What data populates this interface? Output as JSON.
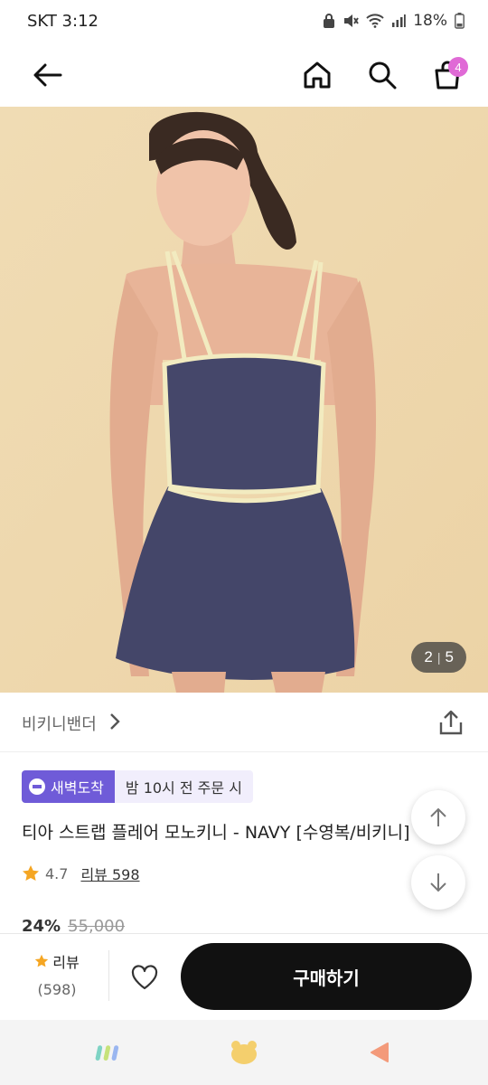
{
  "status_bar": {
    "carrier_time": "SKT  3:12",
    "battery": "18%",
    "icons": [
      "lock-icon",
      "mute-icon",
      "wifi-icon",
      "signal-icon",
      "battery-icon"
    ]
  },
  "header": {
    "cart_count": "4",
    "icons": [
      "back-arrow-icon",
      "home-icon",
      "search-icon",
      "cart-icon"
    ]
  },
  "gallery": {
    "current": "2",
    "separator": "|",
    "total": "5"
  },
  "brand": {
    "name": "비키니밴더"
  },
  "badges": {
    "primary": "새벽도착",
    "secondary": "밤 10시 전 주문 시"
  },
  "product": {
    "title": "티아 스트랩 플레어 모노키니 - NAVY [수영복/비키니]",
    "rating": "4.7",
    "reviews_link": "리뷰 598",
    "discount": "24%",
    "original_price": "55,000"
  },
  "action_bar": {
    "review_label": "리뷰",
    "review_count": "(598)",
    "buy_label": "구매하기"
  },
  "colors": {
    "accent_purple": "#6f5bd8",
    "cart_badge": "#e06ad6",
    "buy_button": "#111111",
    "star": "#f5a623"
  }
}
